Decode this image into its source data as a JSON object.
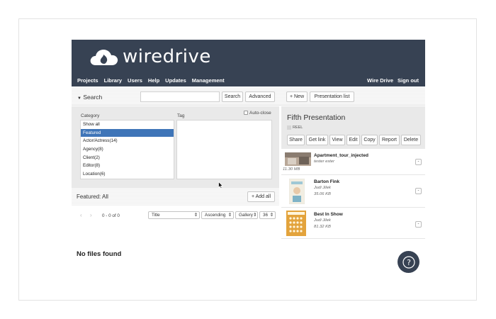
{
  "header": {
    "logo_text": "wiredrive",
    "nav": [
      "Projects",
      "Library",
      "Users",
      "Help",
      "Updates",
      "Management"
    ],
    "nav_right": [
      "Wire Drive",
      "Sign out"
    ]
  },
  "toolbar": {
    "search_toggle": "Search",
    "search_value": "",
    "search_button": "Search",
    "advanced_button": "Advanced",
    "new_button": "+ New",
    "presentation_list_button": "Presentation list"
  },
  "filters": {
    "category_label": "Category",
    "tag_label": "Tag",
    "auto_close_label": "Auto-close",
    "categories": [
      {
        "label": "Show all",
        "selected": false
      },
      {
        "label": "Featured",
        "selected": true
      },
      {
        "label": "Actor/Actress(14)",
        "selected": false
      },
      {
        "label": "Agency(8)",
        "selected": false
      },
      {
        "label": "Client(2)",
        "selected": false
      },
      {
        "label": "Editor(8)",
        "selected": false
      },
      {
        "label": "Location(6)",
        "selected": false
      }
    ]
  },
  "featured": {
    "label": "Featured: All",
    "add_all": "+ Add all"
  },
  "pager": {
    "range": "0 - 0 of 0",
    "sort_field": "Title",
    "sort_order": "Ascending",
    "view": "Gallery",
    "per_page": "36"
  },
  "empty_state": "No files found",
  "presentation": {
    "title": "Fifth Presentation",
    "tag": "REEL",
    "actions": [
      "Share",
      "Get link",
      "View",
      "Edit",
      "Copy",
      "Report",
      "Delete"
    ],
    "files": [
      {
        "name": "Apartment_tour_injected",
        "author": "tester ester",
        "size": "11.30 MB"
      },
      {
        "name": "Barton Fink",
        "author": "Judi Jilek",
        "size": "35.06 KB"
      },
      {
        "name": "Best In Show",
        "author": "Judi Jilek",
        "size": "81.32 KB"
      }
    ],
    "row_action": "-"
  },
  "colors": {
    "header_bg": "#374253",
    "selected_bg": "#3f75b8",
    "panel_bg": "#e9e9e9"
  }
}
